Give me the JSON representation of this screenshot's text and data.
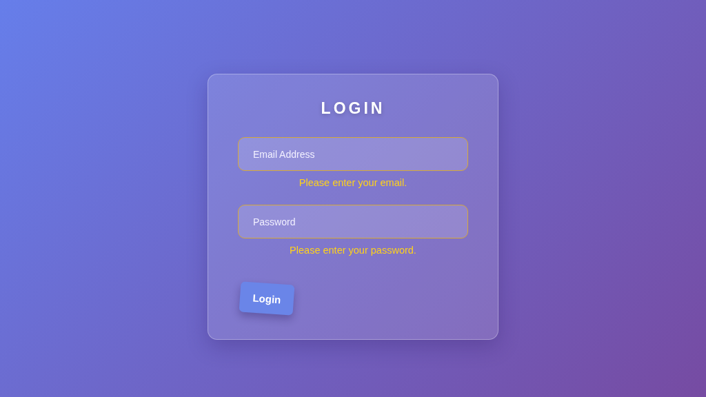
{
  "form": {
    "title": "LOGIN",
    "fields": [
      {
        "placeholder": "Email Address",
        "invalid": true,
        "error": "Please enter your email."
      },
      {
        "placeholder": "Password",
        "invalid": true,
        "error": "Please enter your password."
      }
    ],
    "submit": "Login"
  }
}
